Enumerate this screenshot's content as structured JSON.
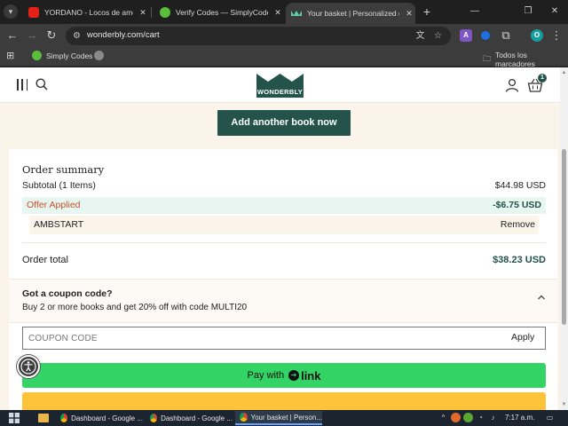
{
  "browser": {
    "tabs": [
      {
        "title": "YORDANO - Locos de amor - Y",
        "active": false
      },
      {
        "title": "Verify Codes — SimplyCodes",
        "active": false
      },
      {
        "title": "Your basket | Personalized chil",
        "active": true
      }
    ],
    "url": "wonderbly.com/cart",
    "bookmarks": {
      "simply_codes": "Simply Codes",
      "all_bookmarks": "Todos los marcadores"
    },
    "extensions": [
      "A",
      "O"
    ]
  },
  "site": {
    "logo_text": "WONDERBLY",
    "basket_count": "1",
    "add_book_label": "Add another book now"
  },
  "summary": {
    "title": "Order summary",
    "subtotal_label": "Subtotal (1 Items)",
    "subtotal_value": "$44.98 USD",
    "offer_label": "Offer Applied",
    "offer_value": "-$6.75 USD",
    "coupon_code": "AMBSTART",
    "remove_label": "Remove",
    "total_label": "Order total",
    "total_value": "$38.23 USD"
  },
  "coupon": {
    "title": "Got a coupon code?",
    "subtitle": "Buy 2 or more books and get 20% off with code MULTI20",
    "placeholder": "COUPON CODE",
    "apply_label": "Apply"
  },
  "payment": {
    "pay_with": "Pay with",
    "link_label": "link"
  },
  "taskbar": {
    "apps": [
      {
        "title": "Dashboard - Google ...",
        "active": false
      },
      {
        "title": "Dashboard - Google ...",
        "active": false
      },
      {
        "title": "Your basket | Person...",
        "active": true
      }
    ],
    "clock": "7:17 a.m."
  },
  "colors": {
    "brand": "#23534b",
    "offer_text": "#c4532b",
    "pay_link": "#33d366",
    "paypal": "#ffc43a",
    "page_bg": "#fbf4ea"
  }
}
